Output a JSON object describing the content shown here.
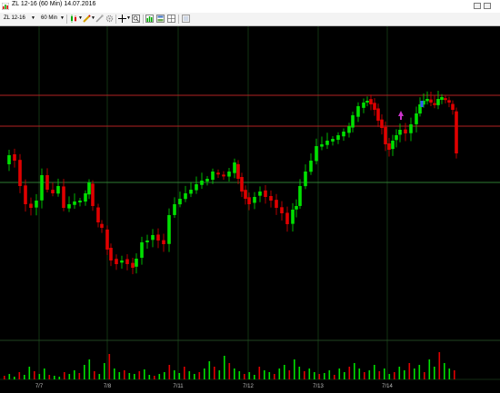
{
  "window": {
    "title": "ZL 12-16 (60 Min)  14.07.2016"
  },
  "toolbar": {
    "symbol": "ZL 12-16",
    "timeframe": "60 Min"
  },
  "colors": {
    "up": "#00e000",
    "down": "#e00000",
    "background": "#000000",
    "grid": "#1a4a1a"
  },
  "chart_data": {
    "type": "candlestick",
    "x_ticks": [
      "7/7",
      "7/8",
      "7/11",
      "7/12",
      "7/13",
      "7/14"
    ],
    "horizontal_lines": [
      {
        "color": "#b22222",
        "level": "upper resistance"
      },
      {
        "color": "#b22222",
        "level": "lower resistance"
      },
      {
        "color": "#2e7d32",
        "level": "mid support"
      }
    ],
    "markers": [
      {
        "type": "up-arrow",
        "color": "#cc33cc"
      },
      {
        "type": "marker",
        "color": "#3355ff"
      }
    ]
  }
}
